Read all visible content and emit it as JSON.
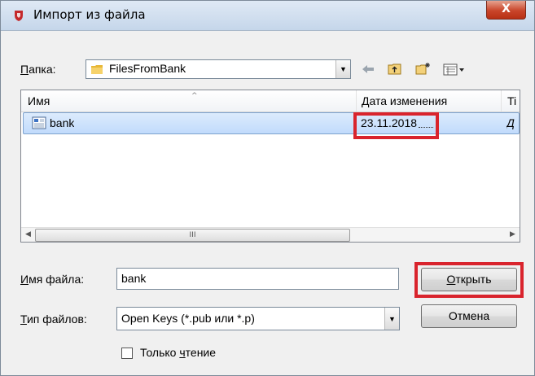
{
  "window": {
    "title": "Импорт из файла",
    "close_label": "X"
  },
  "folder": {
    "label_u": "П",
    "label_rest": "апка:",
    "value": "FilesFromBank"
  },
  "list": {
    "columns": [
      "Имя",
      "Дата изменения",
      "Ti"
    ],
    "rows": [
      {
        "name": "bank",
        "date": "23.11.2018",
        "type": "Д"
      }
    ],
    "scroll_grip": "III"
  },
  "filename": {
    "label_u": "И",
    "label_rest": "мя файла:",
    "value": "bank"
  },
  "filetype": {
    "label_u": "Т",
    "label_rest": "ип файлов:",
    "value": "Open Keys (*.pub или *.p)"
  },
  "buttons": {
    "open_u": "О",
    "open_rest": "ткрыть",
    "cancel": "Отмена"
  },
  "readonly": {
    "label_a": "Только ",
    "label_u": "ч",
    "label_b": "тение"
  },
  "colors": {
    "highlight": "#d9242d",
    "selection": "#c1dbfc"
  }
}
